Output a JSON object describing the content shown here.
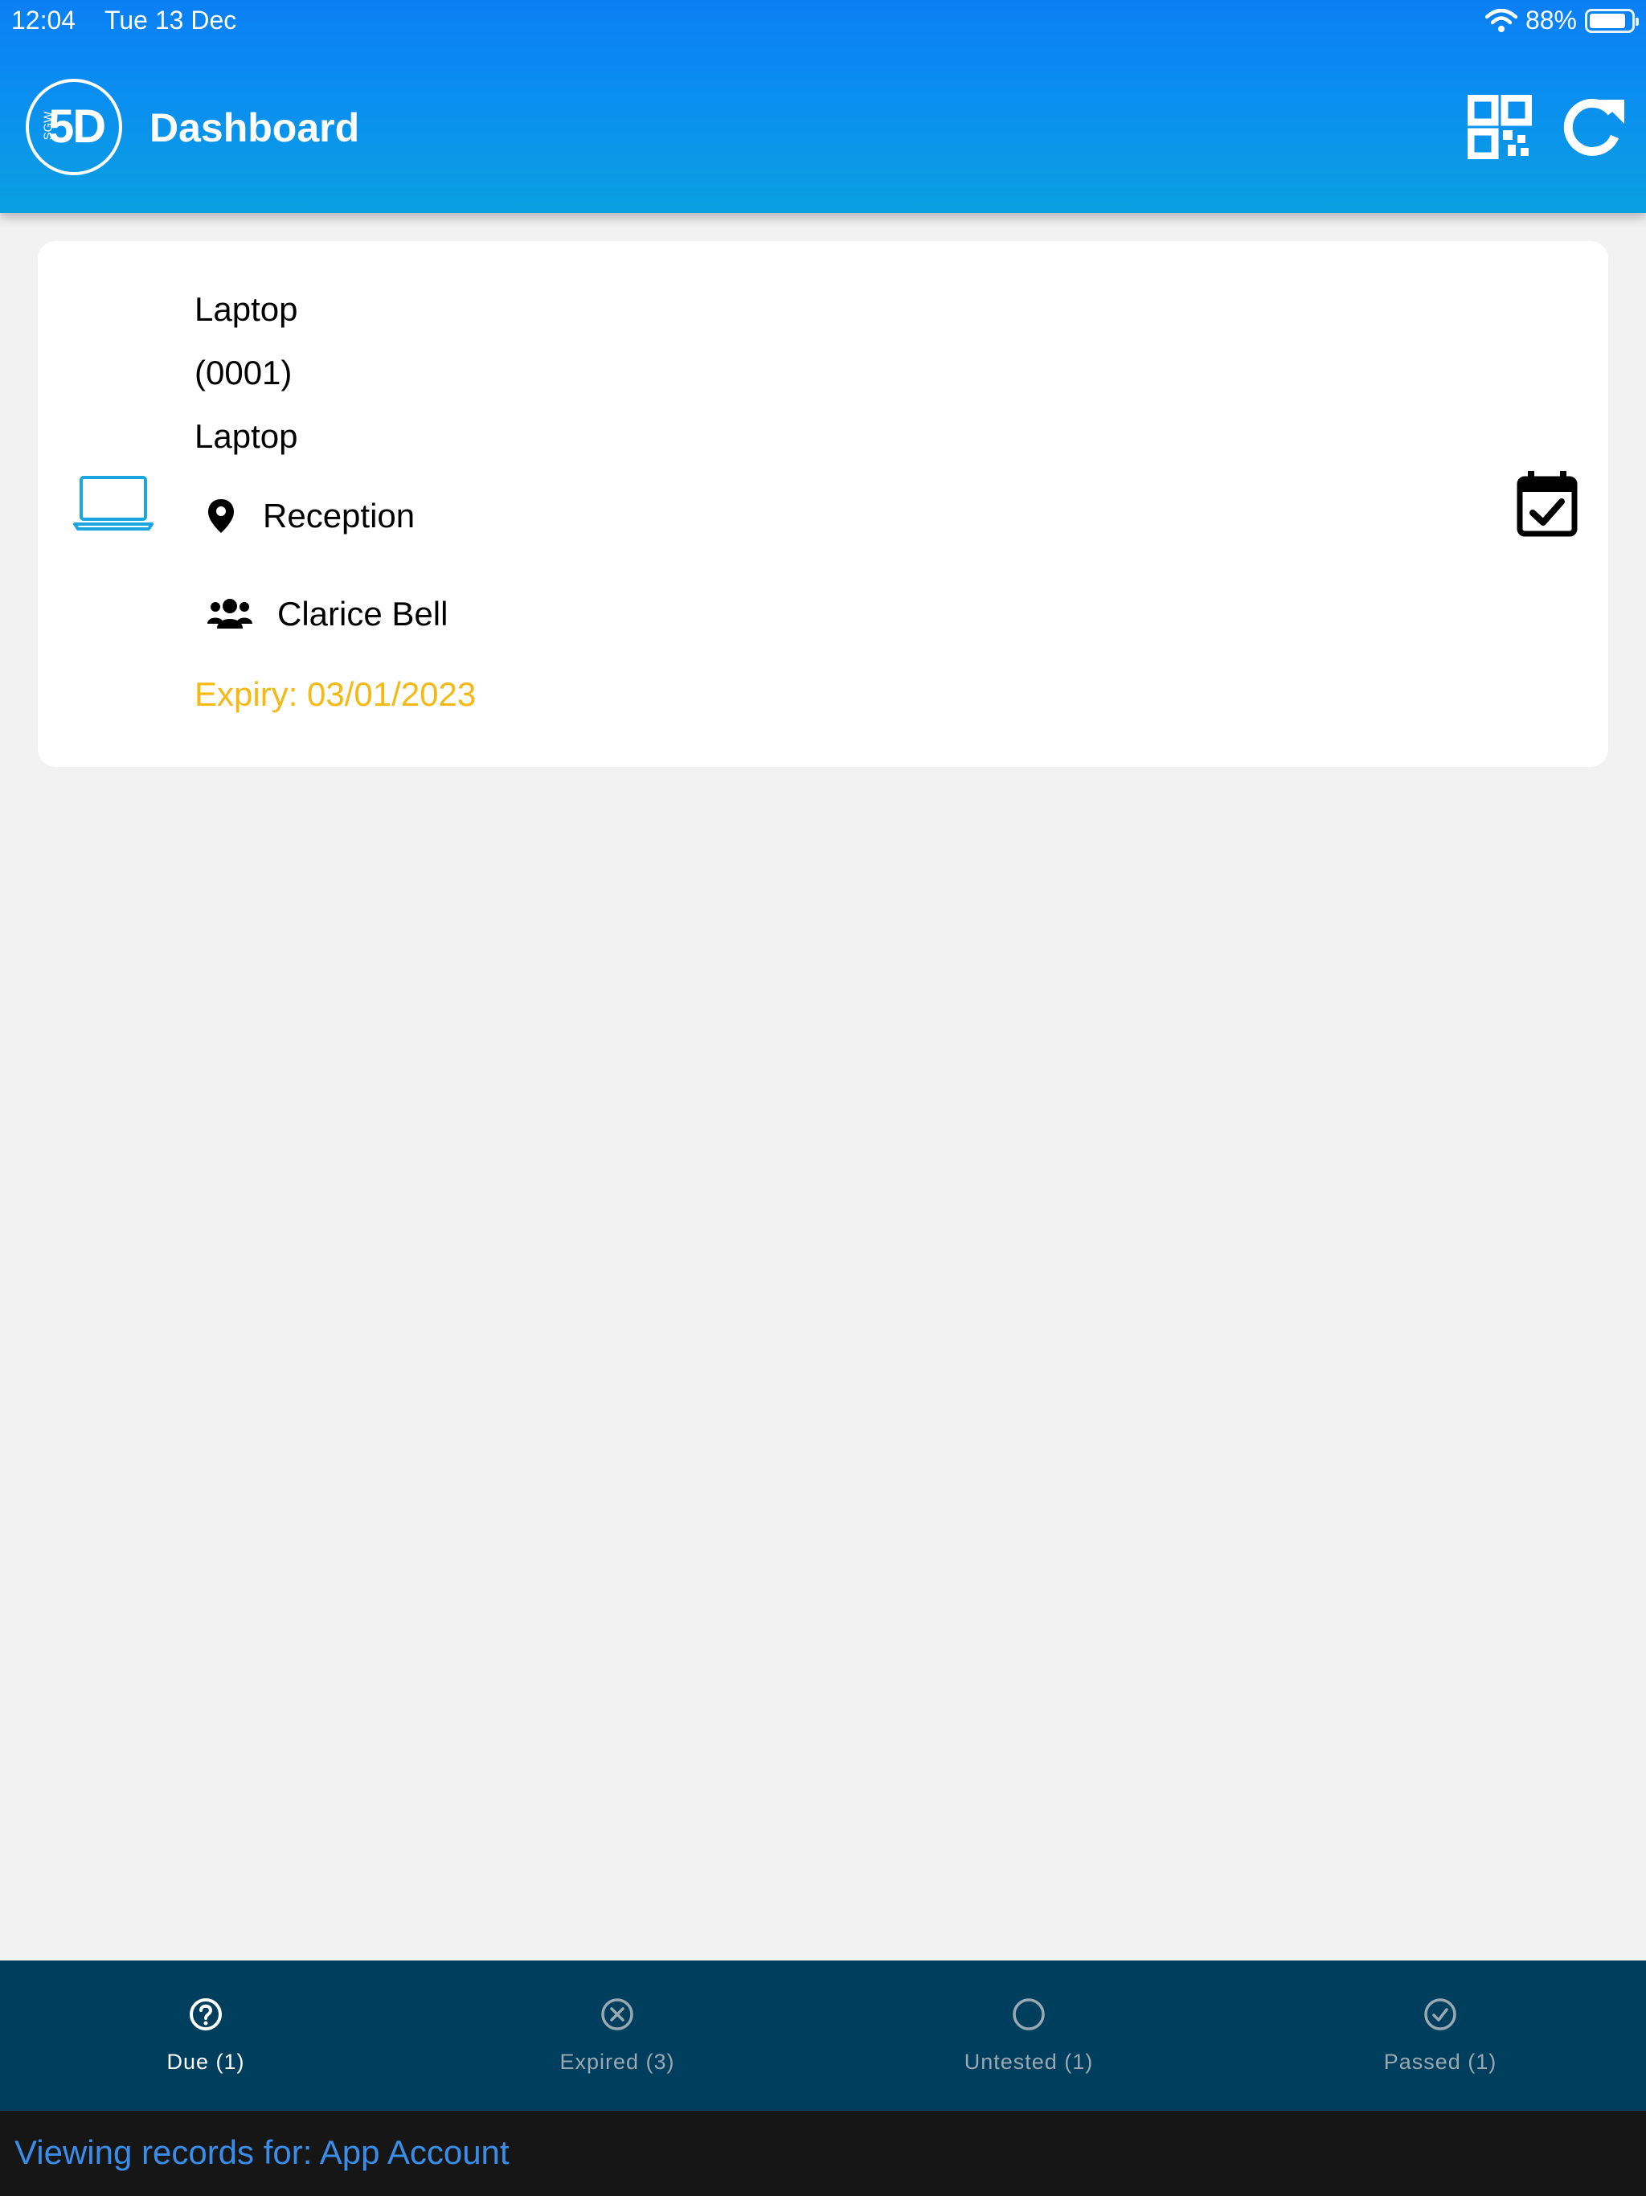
{
  "status_bar": {
    "time": "12:04",
    "date": "Tue 13 Dec",
    "battery": "88%",
    "battery_level": 0.88
  },
  "header": {
    "logo_text": "5D",
    "logo_subtext": "SGW",
    "title": "Dashboard"
  },
  "asset": {
    "name": "Laptop",
    "code": "(0001)",
    "type": "Laptop",
    "location": "Reception",
    "owner": "Clarice Bell",
    "expiry": "Expiry: 03/01/2023"
  },
  "tabs": [
    {
      "label": "Due (1)",
      "icon": "question-circle-icon",
      "active": true
    },
    {
      "label": "Expired (3)",
      "icon": "x-circle-icon",
      "active": false
    },
    {
      "label": "Untested (1)",
      "icon": "circle-icon",
      "active": false
    },
    {
      "label": "Passed (1)",
      "icon": "check-circle-icon",
      "active": false
    }
  ],
  "footer": {
    "viewing_text": "Viewing records for:  App Account"
  },
  "colors": {
    "header_blue": "#0a8ef0",
    "device_icon": "#1aa7e0",
    "expiry": "#f5b914",
    "tab_bar": "#003e5e",
    "tab_active": "#ffffff",
    "tab_inactive": "#9aa8b2",
    "footer_bg": "#161616",
    "footer_text": "#3a8eea"
  }
}
